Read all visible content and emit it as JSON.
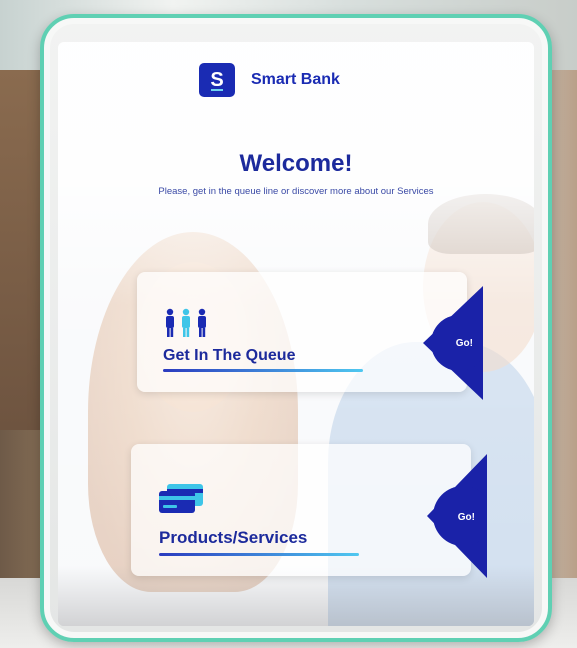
{
  "app": {
    "brand_name": "Smart Bank",
    "logo_letter": "S"
  },
  "welcome": {
    "title": "Welcome!",
    "subtitle": "Please, get in the queue line or discover more about our Services"
  },
  "cards": [
    {
      "label": "Get In The Queue",
      "action_label": "Go!",
      "icon": "people-queue-icon"
    },
    {
      "label": "Products/Services",
      "action_label": "Go!",
      "icon": "credit-cards-icon"
    }
  ],
  "colors": {
    "primary": "#1a2bb3",
    "accent": "#4fc8f0",
    "frame": "#5fd0b3"
  }
}
